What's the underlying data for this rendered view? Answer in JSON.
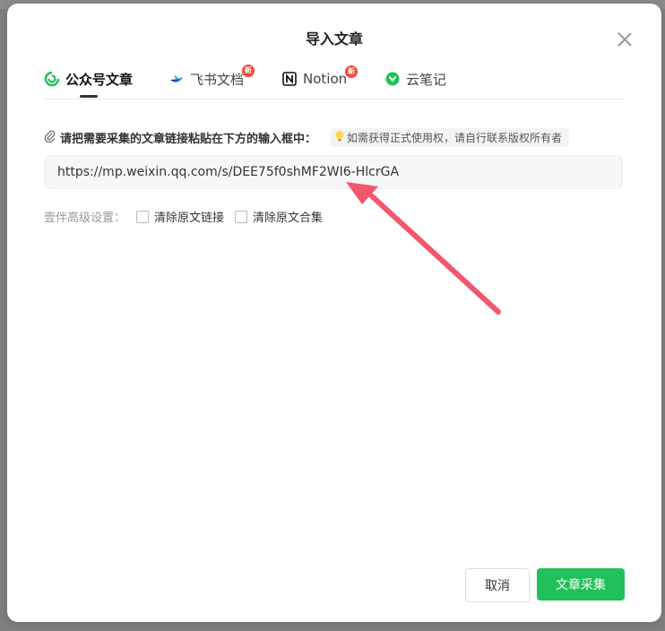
{
  "dialog": {
    "title": "导入文章"
  },
  "tabs": [
    {
      "label": "公众号文章",
      "icon": "wechat-article-icon",
      "active": true
    },
    {
      "label": "飞书文档",
      "icon": "feishu-icon",
      "badge": "新"
    },
    {
      "label": "Notion",
      "icon": "notion-icon",
      "badge": "新"
    },
    {
      "label": "云笔记",
      "icon": "cloud-note-icon"
    }
  ],
  "instruction": {
    "text": "请把需要采集的文章链接粘贴在下方的输入框中：",
    "hint": "如需获得正式使用权，请自行联系版权所有者"
  },
  "url_input": {
    "value": "https://mp.weixin.qq.com/s/DEE75f0shMF2WI6-HlcrGA"
  },
  "advanced": {
    "label": "壹伴高级设置：",
    "options": [
      {
        "label": "清除原文链接",
        "checked": false
      },
      {
        "label": "清除原文合集",
        "checked": false
      }
    ]
  },
  "buttons": {
    "cancel": "取消",
    "submit": "文章采集"
  },
  "colors": {
    "primary": "#20c05a",
    "badge": "#f24a3c",
    "arrow": "#f2576e"
  }
}
